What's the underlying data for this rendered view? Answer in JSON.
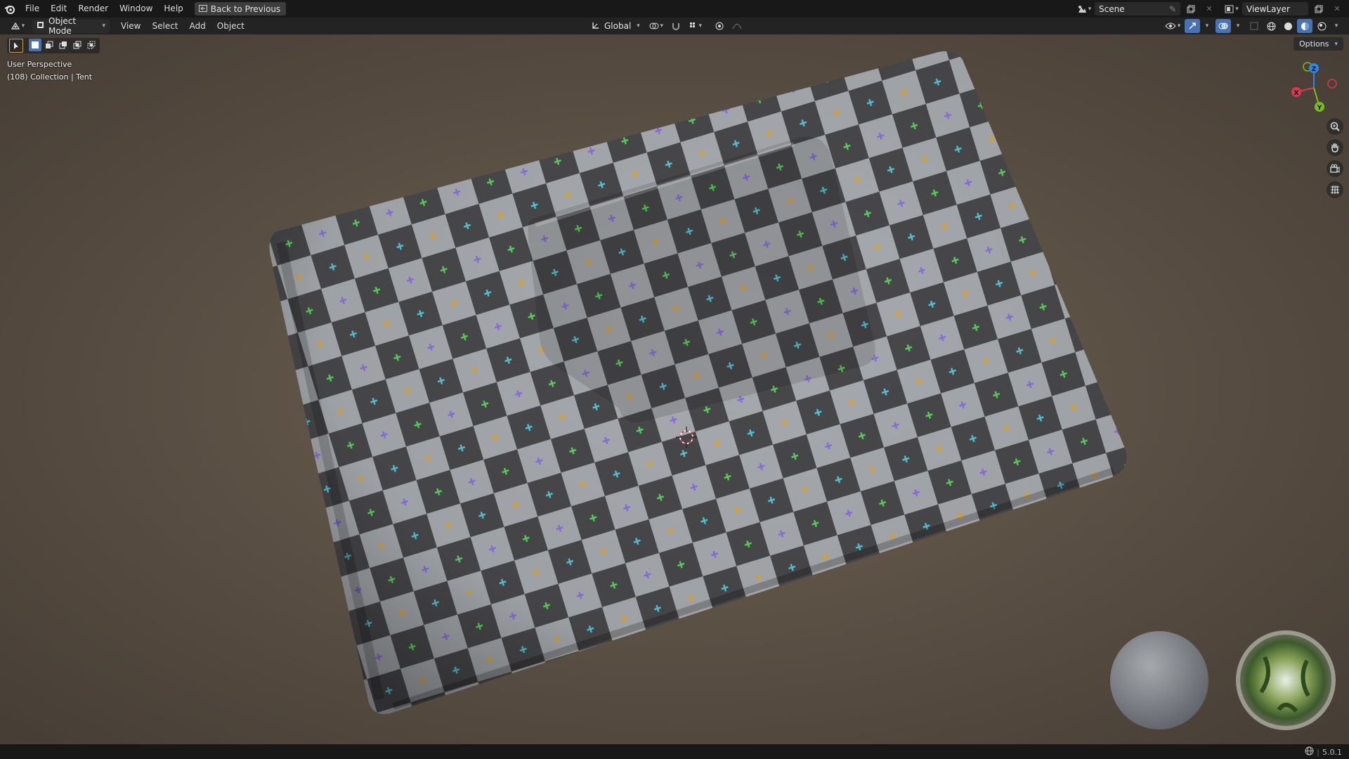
{
  "app": {
    "logo": "blender-logo-icon"
  },
  "menu": {
    "items": [
      "File",
      "Edit",
      "Render",
      "Window",
      "Help"
    ],
    "back_button": "Back to Previous"
  },
  "scene": {
    "name": "Scene"
  },
  "view_layer": {
    "name": "ViewLayer"
  },
  "header": {
    "mode": "Object Mode",
    "menus": [
      "View",
      "Select",
      "Add",
      "Object"
    ],
    "transform_orientation": "Global"
  },
  "viewport": {
    "perspective": "User Perspective",
    "collection_info": "(108) Collection | Tent",
    "options_label": "Options"
  },
  "gizmo": {
    "x": "X",
    "y": "Y",
    "z": "Z"
  },
  "status": {
    "version": "5.0.1"
  },
  "colors": {
    "accent": "#4772b3",
    "x_axis": "#e0364d",
    "y_axis": "#7cbd1e",
    "z_axis": "#2e86e5",
    "checker_light": "#a7aaae",
    "checker_dark": "#4a4a4c"
  }
}
